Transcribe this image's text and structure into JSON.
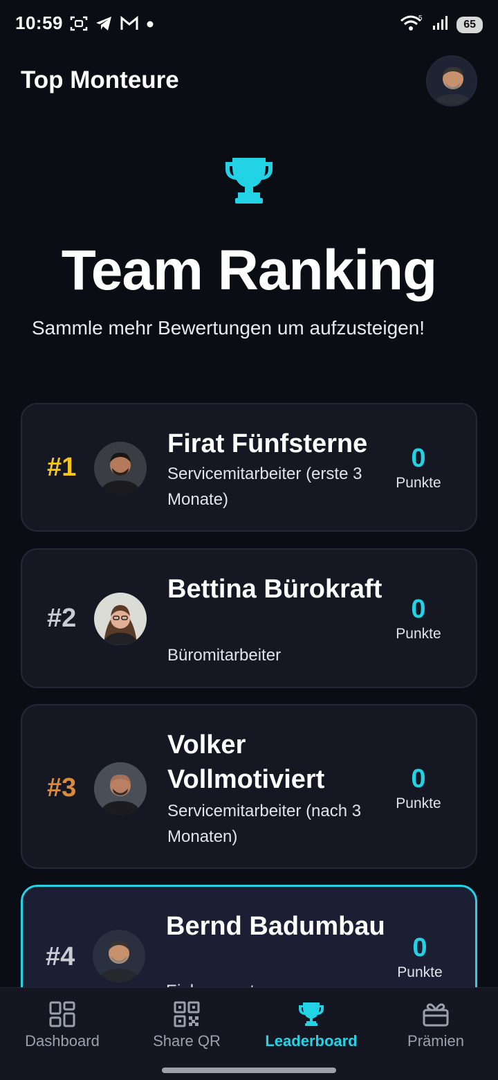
{
  "status": {
    "time": "10:59",
    "battery": "65",
    "left_icons": [
      "screenshot-icon",
      "telegram-icon",
      "gmail-icon",
      "dot-icon"
    ],
    "right_icons": [
      "wifi-icon",
      "signal-icon",
      "battery-icon"
    ]
  },
  "header": {
    "title": "Top Monteure",
    "avatar_icon": "profile-avatar"
  },
  "hero": {
    "icon": "trophy-icon",
    "title": "Team Ranking",
    "subtitle": "Sammle mehr Bewertungen um aufzusteigen!"
  },
  "ranking": [
    {
      "rank": "#1",
      "name": "Firat Fünfsterne",
      "role": "Servicemitarbeiter (erste 3 Monate)",
      "points": "0",
      "points_label": "Punkte",
      "rank_color": "#f5c518"
    },
    {
      "rank": "#2",
      "name": "Bettina Bürokraft",
      "role": "Büromitarbeiter",
      "points": "0",
      "points_label": "Punkte",
      "rank_color": "#c9ccd3"
    },
    {
      "rank": "#3",
      "name": "Volker Vollmotiviert",
      "role": "Servicemitarbeiter (nach 3 Monaten)",
      "points": "0",
      "points_label": "Punkte",
      "rank_color": "#d98a3a"
    },
    {
      "rank": "#4",
      "name": "Bernd Badumbau",
      "role": "Einbaumonteur",
      "points": "0",
      "points_label": "Punkte",
      "rank_color": "#c9ccd3"
    }
  ],
  "nav": {
    "items": [
      {
        "label": "Dashboard",
        "icon": "dashboard-icon"
      },
      {
        "label": "Share QR",
        "icon": "qr-code-icon"
      },
      {
        "label": "Leaderboard",
        "icon": "trophy-icon"
      },
      {
        "label": "Prämien",
        "icon": "gift-icon"
      }
    ],
    "active": "Leaderboard"
  },
  "colors": {
    "accent": "#22d3e6",
    "background": "#0b0d14",
    "card": "#151823",
    "gold": "#f5c518",
    "bronze": "#d98a3a"
  }
}
